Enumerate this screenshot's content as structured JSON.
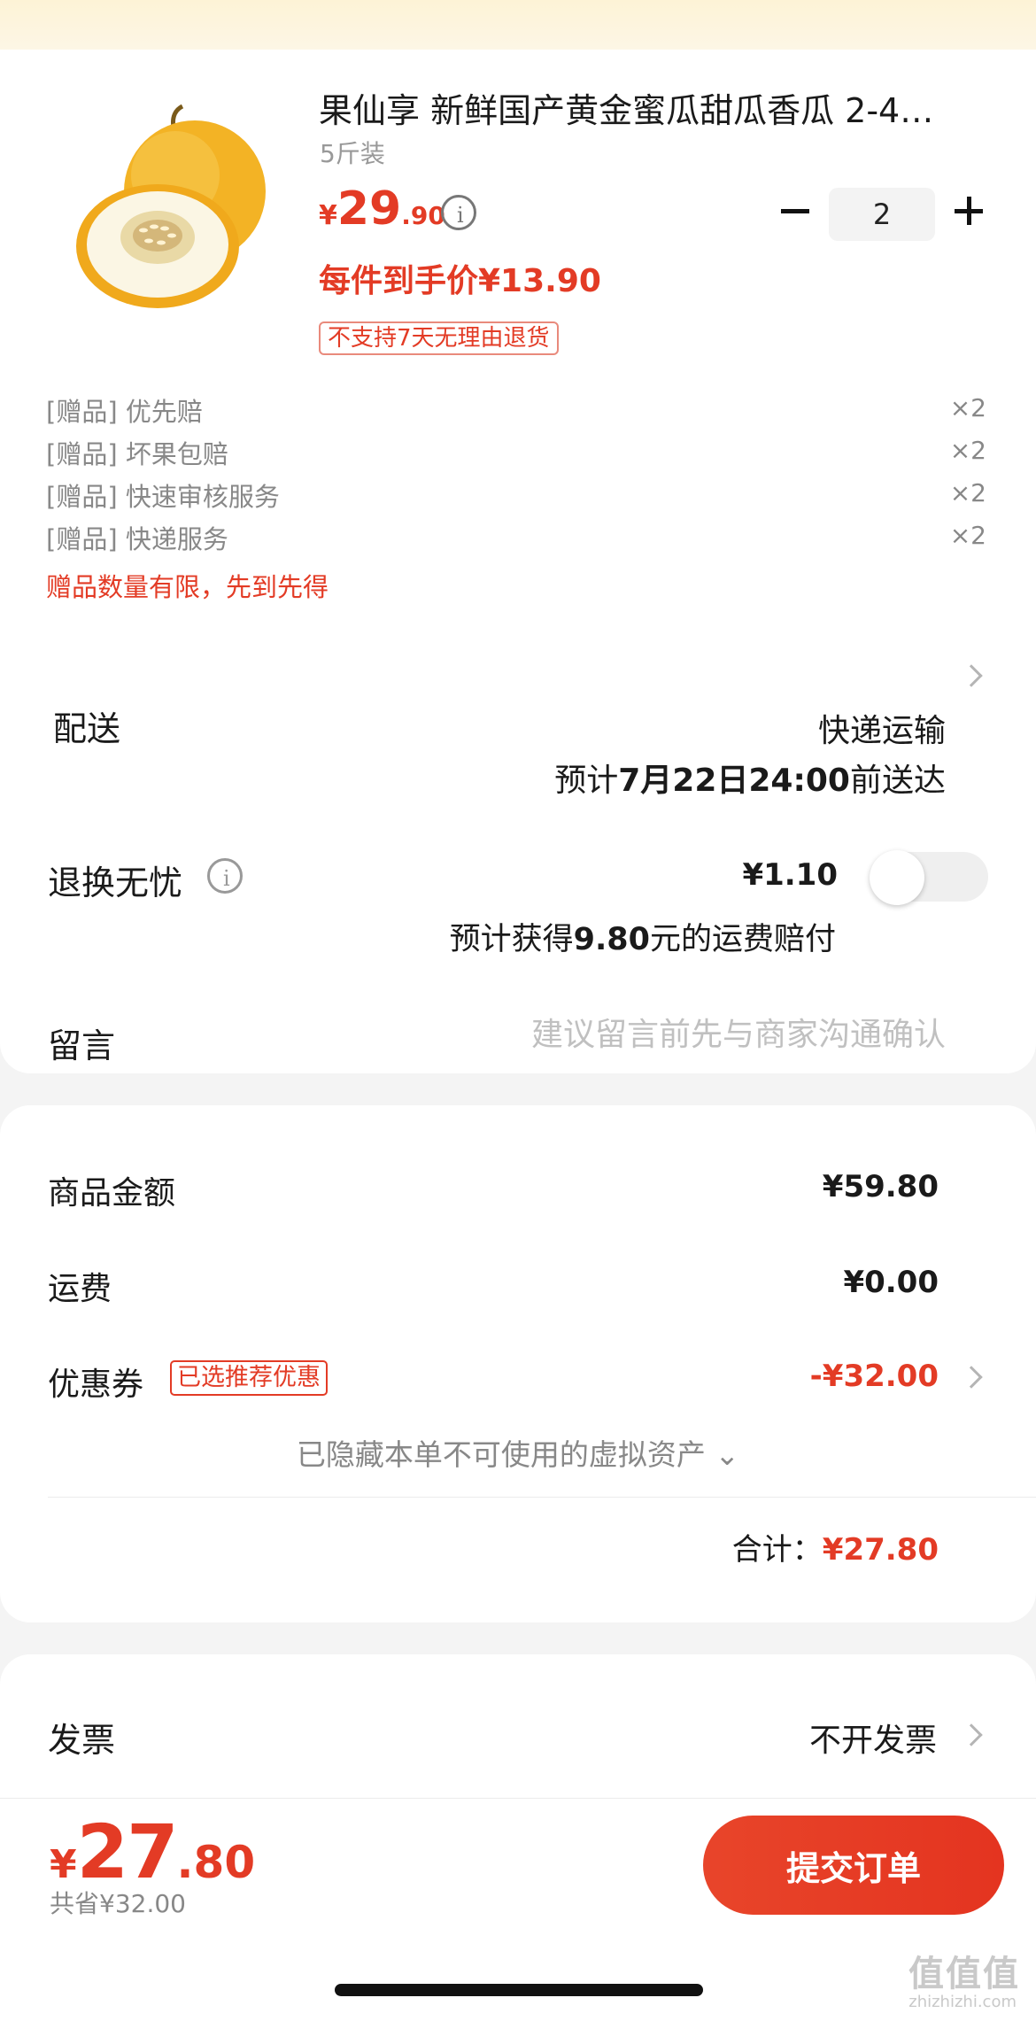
{
  "product": {
    "title": "果仙享 新鲜国产黄金蜜瓜甜瓜香瓜 2-4…",
    "spec": "5斤装",
    "price_currency": "¥",
    "price_int": "29",
    "price_dec": ".90",
    "quantity": "2",
    "unit_price": "每件到手价¥13.90",
    "no_return_badge": "不支持7天无理由退货"
  },
  "gifts": [
    {
      "label": "[赠品] 优先赔",
      "qty": "×2"
    },
    {
      "label": "[赠品] 坏果包赔",
      "qty": "×2"
    },
    {
      "label": "[赠品] 快速审核服务",
      "qty": "×2"
    },
    {
      "label": "[赠品] 快递服务",
      "qty": "×2"
    }
  ],
  "gift_note": "赠品数量有限，先到先得",
  "shipping": {
    "label": "配送",
    "method": "快递运输",
    "eta_prefix": "预计",
    "eta_date": "7月22日24:00",
    "eta_suffix": "前送达"
  },
  "return_insurance": {
    "label": "退换无忧",
    "price": "¥1.10",
    "toggle_on": false,
    "note_prefix": "预计获得",
    "note_amount": "9.80",
    "note_suffix": "元的运费赔付"
  },
  "message": {
    "label": "留言",
    "placeholder": "建议留言前先与商家沟通确认"
  },
  "summary": {
    "goods_label": "商品金额",
    "goods_value": "¥59.80",
    "freight_label": "运费",
    "freight_value": "¥0.00",
    "coupon_label": "优惠券",
    "coupon_badge": "已选推荐优惠",
    "coupon_value": "-¥32.00",
    "hidden_assets": "已隐藏本单不可使用的虚拟资产 ⌄",
    "total_label": "合计：",
    "total_value": "¥27.80"
  },
  "invoice": {
    "label": "发票",
    "value": "不开发票"
  },
  "footer": {
    "pay_currency": "¥",
    "pay_int": "27",
    "pay_dec": ".80",
    "saved": "共省¥32.00",
    "submit_label": "提交订单"
  },
  "watermark": {
    "logo": "值值值",
    "site": "zhizhizhi.com"
  },
  "colors": {
    "accent": "#e33b25",
    "background": "#f4f4f4",
    "muted": "#888888"
  }
}
